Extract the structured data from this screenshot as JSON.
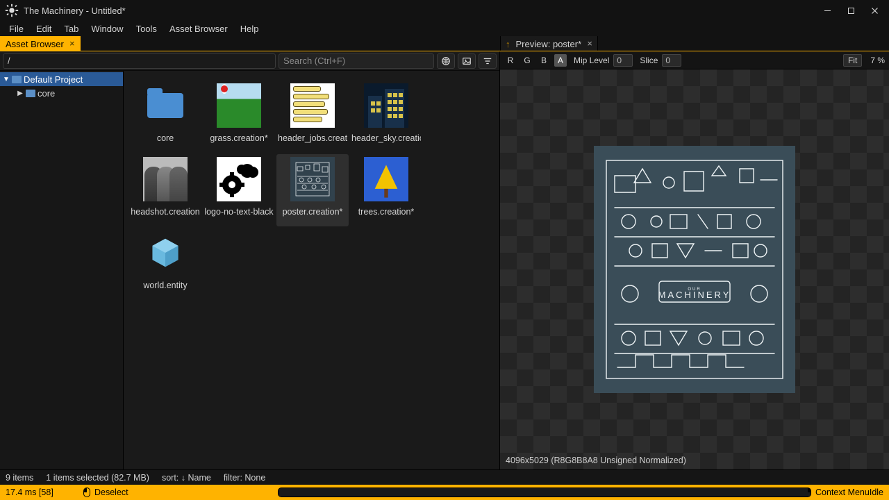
{
  "window": {
    "title": "The Machinery - Untitled*"
  },
  "menu": [
    "File",
    "Edit",
    "Tab",
    "Window",
    "Tools",
    "Asset Browser",
    "Help"
  ],
  "tabs": {
    "main": {
      "label": "Asset Browser"
    },
    "preview": {
      "label": "Preview: poster*"
    }
  },
  "asset_browser": {
    "path": "/",
    "search_placeholder": "Search (Ctrl+F)",
    "tree": {
      "root": "Default Project",
      "children": [
        "core"
      ]
    },
    "assets": [
      {
        "name": "core",
        "kind": "folder"
      },
      {
        "name": "grass.creation*",
        "kind": "grass"
      },
      {
        "name": "header_jobs.creation*",
        "kind": "jobs",
        "display": "header_jobs.creati"
      },
      {
        "name": "header_sky.creation*",
        "kind": "sky",
        "display": "header_sky.creatio"
      },
      {
        "name": "headshot.creation*",
        "kind": "head",
        "display": "headshot.creation"
      },
      {
        "name": "logo-no-text-black",
        "kind": "logo",
        "display": "logo-no-text-black"
      },
      {
        "name": "poster.creation*",
        "kind": "poster",
        "selected": true
      },
      {
        "name": "trees.creation*",
        "kind": "trees"
      },
      {
        "name": "world.entity",
        "kind": "world"
      }
    ],
    "status": {
      "items": "9 items",
      "selected": "1 items selected (82.7 MB)",
      "sort": "sort: ↓ Name",
      "filter": "filter: None"
    }
  },
  "preview": {
    "channels": [
      "R",
      "G",
      "B",
      "A"
    ],
    "active_channel": "A",
    "mip_label": "Mip Level",
    "mip_value": "0",
    "slice_label": "Slice",
    "slice_value": "0",
    "fit_label": "Fit",
    "zoom": "7 %",
    "footer": "4096x5029 (R8G8B8A8 Unsigned Normalized)",
    "poster_text": "MACHINERY",
    "poster_text_small": "OUR"
  },
  "bottom": {
    "perf": "17.4 ms [58]",
    "left_action": "Deselect",
    "right_action": "Context Menu",
    "state": "Idle"
  }
}
